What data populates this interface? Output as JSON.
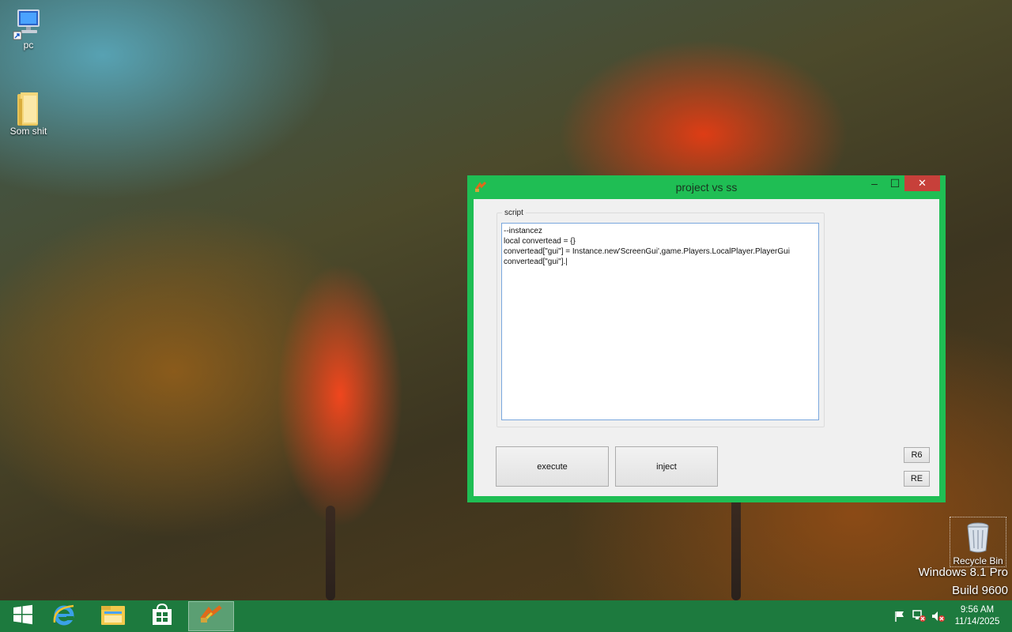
{
  "desktop": {
    "icons": [
      {
        "label": "pc",
        "icon": "computer-icon"
      },
      {
        "label": "Som shit",
        "icon": "folder-icon"
      }
    ],
    "recycle_bin": {
      "label": "Recycle Bin",
      "icon": "recycle-bin-icon"
    },
    "watermark": {
      "line1": "Windows 8.1 Pro",
      "line2": "Build 9600"
    }
  },
  "window": {
    "title": "project vs ss",
    "icon": "app-icon",
    "controls": {
      "minimize": "–",
      "maximize": "☐",
      "close": "✕"
    },
    "script_group_label": "script",
    "script_text": "--instancez\nlocal convertead = {}\nconvertead[\"gui\"] = Instance.new'ScreenGui',game.Players.LocalPlayer.PlayerGui\nconvertead[\"gui\"].|",
    "buttons": {
      "execute": "execute",
      "inject": "inject",
      "r6": "R6",
      "re": "RE"
    },
    "colors": {
      "frame": "#1fbe54",
      "close": "#c7403a"
    }
  },
  "taskbar": {
    "items": [
      {
        "name": "start-button",
        "icon": "windows-logo-icon"
      },
      {
        "name": "internet-explorer",
        "icon": "internet-explorer-icon"
      },
      {
        "name": "file-explorer",
        "icon": "file-explorer-icon"
      },
      {
        "name": "store",
        "icon": "store-icon"
      },
      {
        "name": "project-vs-ss",
        "icon": "app-icon",
        "active": true
      }
    ],
    "tray": [
      "flag-icon",
      "network-icon",
      "volume-muted-icon"
    ],
    "clock": {
      "time": "9:56 AM",
      "date": "11/14/2025"
    },
    "color": "#1d7a3e"
  }
}
